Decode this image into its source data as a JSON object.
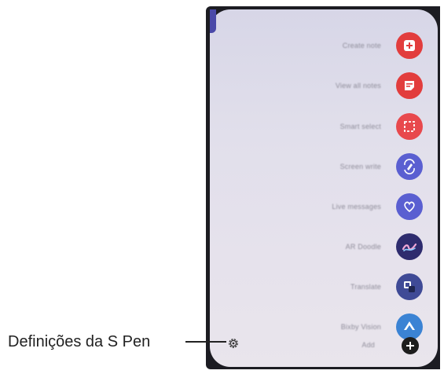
{
  "callout": {
    "label": "Definições da S Pen"
  },
  "menu": {
    "items": [
      {
        "label": "Create note",
        "icon": "create-note-icon",
        "color": "#e23d3d"
      },
      {
        "label": "View all notes",
        "icon": "view-notes-icon",
        "color": "#e23d3d"
      },
      {
        "label": "Smart select",
        "icon": "smart-select-icon",
        "color": "#e8494d"
      },
      {
        "label": "Screen write",
        "icon": "screen-write-icon",
        "color": "#5a5fd1"
      },
      {
        "label": "Live messages",
        "icon": "live-messages-icon",
        "color": "#5a5fd1"
      },
      {
        "label": "AR Doodle",
        "icon": "ar-doodle-icon",
        "color": "#2e2c6e"
      },
      {
        "label": "Translate",
        "icon": "translate-icon",
        "color": "#3f4a96"
      },
      {
        "label": "Bixby Vision",
        "icon": "bixby-vision-icon",
        "color": "#3b83d4"
      },
      {
        "label": "Add",
        "icon": "add-icon",
        "color": "#1d1d1d"
      }
    ]
  }
}
